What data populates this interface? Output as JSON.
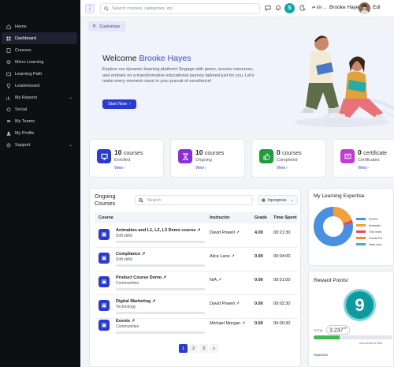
{
  "sidebar": {
    "items": [
      {
        "label": "Home",
        "icon": "home-icon"
      },
      {
        "label": "Dashboard",
        "icon": "grid-icon",
        "active": true
      },
      {
        "label": "Courses",
        "icon": "book-icon"
      },
      {
        "label": "Micro Learning",
        "icon": "layers-icon"
      },
      {
        "label": "Learning Path",
        "icon": "path-icon"
      },
      {
        "label": "Leaderboard",
        "icon": "trophy-icon"
      },
      {
        "label": "My Reports",
        "icon": "report-icon",
        "chevron": true
      },
      {
        "label": "Social",
        "icon": "social-icon"
      },
      {
        "label": "My Teams",
        "icon": "team-icon"
      },
      {
        "label": "My Profile",
        "icon": "profile-icon"
      },
      {
        "label": "Support",
        "icon": "support-icon",
        "chevron": true
      }
    ]
  },
  "topbar": {
    "search_placeholder": "Search courses, categories, etc.",
    "avatar_letter": "S",
    "language": "EN",
    "user_name": "Brooke Hayes",
    "edit_label": "Edi"
  },
  "customize_label": "Customize",
  "welcome": {
    "greeting": "Welcome ",
    "name": "Brooke Hayes",
    "message": "Explore our dynamic learning platform! Engage with peers, access resources, and embark on a transformative educational journey tailored just for you. Let's make every moment count in your pursuit of excellence!",
    "start_label": "Start Now"
  },
  "stats": [
    {
      "count": "10",
      "unit": "courses",
      "label": "Enrolled",
      "view": "View",
      "color": "#2a3bd4",
      "icon": "monitor-icon"
    },
    {
      "count": "10",
      "unit": "courses",
      "label": "Ongoing",
      "view": "View",
      "color": "#8b2fd6",
      "icon": "hourglass-icon"
    },
    {
      "count": "0",
      "unit": "courses",
      "label": "Completed",
      "view": "View",
      "color": "#1f9d3a",
      "icon": "thumbs-up-icon"
    },
    {
      "count": "0",
      "unit": "certificate",
      "label": "Certificates",
      "view": "View",
      "color": "#c43ad6",
      "icon": "certificate-icon"
    }
  ],
  "ongoing": {
    "title": "Ongoing Courses",
    "search_placeholder": "Search",
    "filter": "Inprogress",
    "columns": [
      "Course",
      "Instructor",
      "Grade",
      "Time Spent"
    ],
    "rows": [
      {
        "name": "Animation and L1, L2, L3 Demo course",
        "category": "Soft skills",
        "instructor": "David Powell",
        "grade": "4.00",
        "time": "00:21:30"
      },
      {
        "name": "Compliance",
        "category": "Soft skills",
        "instructor": "Alice Lane",
        "grade": "0.00",
        "time": "00:04:00"
      },
      {
        "name": "Product Course Demo",
        "category": "Communities",
        "instructor": "N/A",
        "grade": "0.00",
        "time": "00:01:00"
      },
      {
        "name": "Digital Marketing",
        "category": "Technology",
        "instructor": "David Powell",
        "grade": "0.00",
        "time": "00:02:30"
      },
      {
        "name": "Events",
        "category": "Communities",
        "instructor": "Michael Morgan",
        "grade": "0.00",
        "time": "00:00:30"
      }
    ],
    "pages": [
      "1",
      "2",
      "3",
      "»"
    ]
  },
  "expertise": {
    "title": "My Learning Expertise",
    "legend": [
      "POSH",
      "Animatio",
      "The Web",
      "Social Ro",
      "Help and"
    ],
    "colors": [
      "#4a90e2",
      "#f4a03a",
      "#e24a5a",
      "#f08a3a",
      "#34b8c8"
    ]
  },
  "reward": {
    "title": "Reward Points!",
    "level": "9",
    "total_label": "TOTAL",
    "points": "3,237",
    "points_unit": "XP",
    "progress": 0.33,
    "next_level": "next level in 606",
    "ranking_label": "RANKING"
  }
}
